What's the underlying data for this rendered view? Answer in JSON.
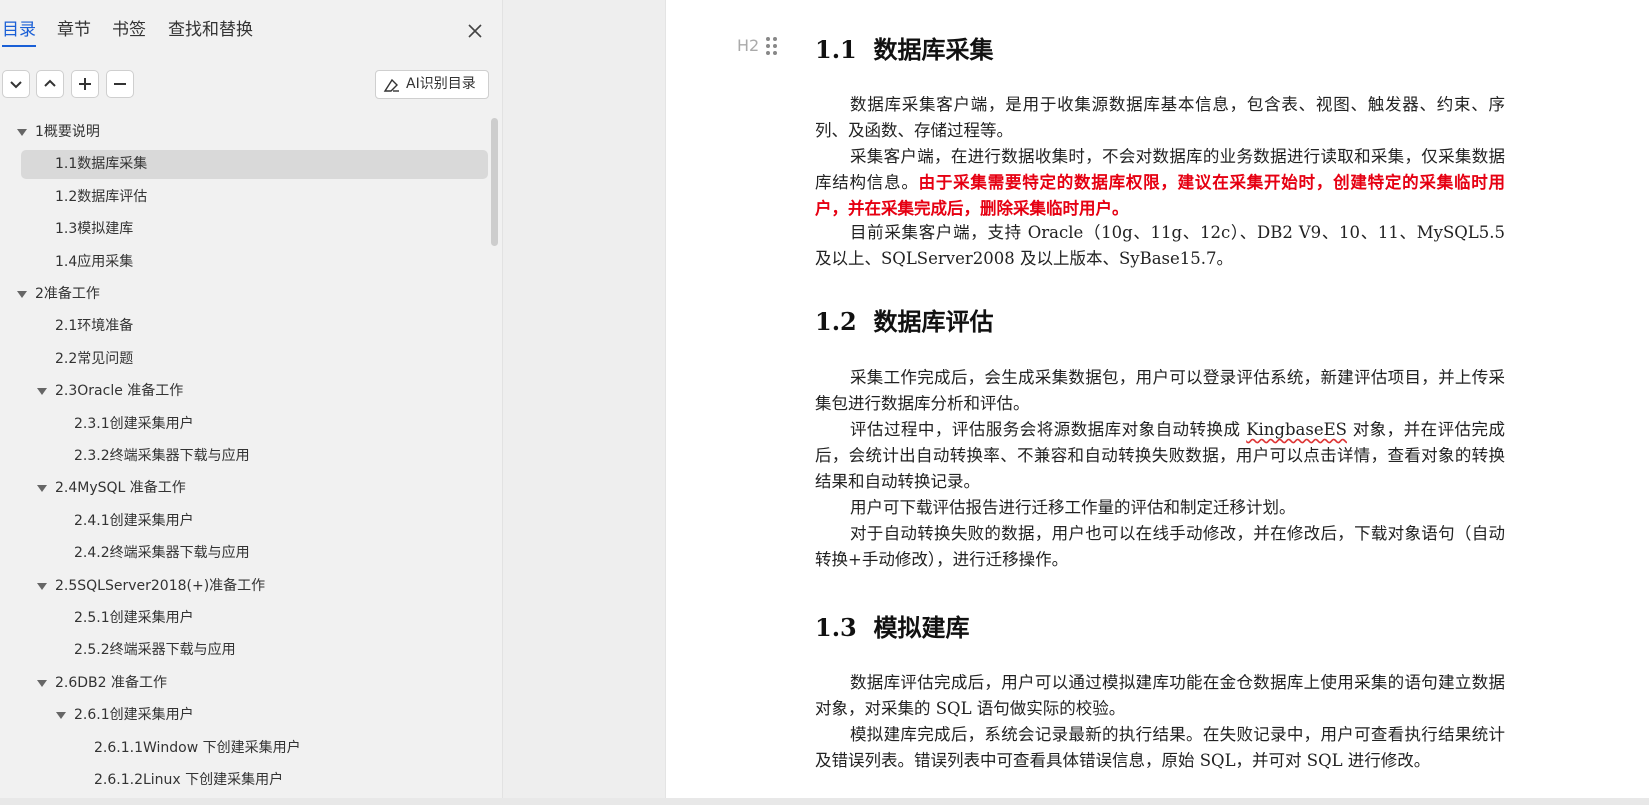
{
  "nav": {
    "tabs": [
      {
        "label": "目录",
        "active": true
      },
      {
        "label": "章节",
        "active": false
      },
      {
        "label": "书签",
        "active": false
      },
      {
        "label": "查找和替换",
        "active": false
      }
    ],
    "ai_button": "AI识别目录",
    "toc": [
      {
        "label": "1概要说明",
        "level": 0,
        "caret": "expanded"
      },
      {
        "label": "1.1数据库采集",
        "level": 1,
        "selected": true
      },
      {
        "label": "1.2数据库评估",
        "level": 1
      },
      {
        "label": "1.3模拟建库",
        "level": 1
      },
      {
        "label": "1.4应用采集",
        "level": 1
      },
      {
        "label": "2准备工作",
        "level": 0,
        "caret": "expanded"
      },
      {
        "label": "2.1环境准备",
        "level": 1
      },
      {
        "label": "2.2常见问题",
        "level": 1
      },
      {
        "label": "2.3Oracle 准备工作",
        "level": 1,
        "caret": "expanded"
      },
      {
        "label": "2.3.1创建采集用户",
        "level": 2
      },
      {
        "label": "2.3.2终端采集器下载与应用",
        "level": 2
      },
      {
        "label": "2.4MySQL 准备工作",
        "level": 1,
        "caret": "expanded"
      },
      {
        "label": "2.4.1创建采集用户",
        "level": 2
      },
      {
        "label": "2.4.2终端采集器下载与应用",
        "level": 2
      },
      {
        "label": "2.5SQLServer2018(+)准备工作",
        "level": 1,
        "caret": "expanded"
      },
      {
        "label": "2.5.1创建采集用户",
        "level": 2
      },
      {
        "label": "2.5.2终端采器下载与应用",
        "level": 2
      },
      {
        "label": "2.6DB2 准备工作",
        "level": 1,
        "caret": "expanded"
      },
      {
        "label": "2.6.1创建采集用户",
        "level": 2,
        "caret": "expanded"
      },
      {
        "label": "2.6.1.1Window 下创建采集用户",
        "level": 3
      },
      {
        "label": "2.6.1.2Linux 下创建采集用户",
        "level": 3
      }
    ]
  },
  "doc": {
    "heading_marker": "H2",
    "sections": [
      {
        "num": "1.1",
        "title": "数据库采集",
        "paragraphs": [
          {
            "parts": [
              {
                "text": "数据库采集客户端，是用于收集源数据库基本信息，包含表、视图、触发器、约束、序列、及函数、存储过程等。"
              }
            ]
          },
          {
            "parts": [
              {
                "text": "采集客户端，在进行数据收集时，不会对数据库的业务数据进行读取和采集，仅采集数据库结构信息。"
              },
              {
                "text": "由于采集需要特定的数据库权限，建议在采集开始时，创建特定的采集临时用户，并在采集完成后，删除采集临时用户。",
                "red": true
              }
            ]
          },
          {
            "parts": [
              {
                "text": "目前采集客户端，支持 Oracle（10g、11g、12c）、DB2 V9、10、11、MySQL5.5 及以上、SQLServer2008 及以上版本、SyBase15.7。"
              }
            ]
          }
        ]
      },
      {
        "num": "1.2",
        "title": "数据库评估",
        "paragraphs": [
          {
            "parts": [
              {
                "text": "采集工作完成后，会生成采集数据包，用户可以登录评估系统，新建评估项目，并上传采集包进行数据库分析和评估。"
              }
            ]
          },
          {
            "parts": [
              {
                "text": "评估过程中，评估服务会将源数据库对象自动转换成 "
              },
              {
                "text": "KingbaseES",
                "wave": true
              },
              {
                "text": " 对象，并在评估完成后，会统计出自动转换率、不兼容和自动转换失败数据，用户可以点击详情，查看对象的转换结果和自动转换记录。"
              }
            ]
          },
          {
            "parts": [
              {
                "text": "用户可下载评估报告进行迁移工作量的评估和制定迁移计划。"
              }
            ]
          },
          {
            "parts": [
              {
                "text": "对于自动转换失败的数据，用户也可以在线手动修改，并在修改后，下载对象语句（自动转换+手动修改），进行迁移操作。"
              }
            ]
          }
        ]
      },
      {
        "num": "1.3",
        "title": "模拟建库",
        "paragraphs": [
          {
            "parts": [
              {
                "text": "数据库评估完成后，用户可以通过模拟建库功能在金仓数据库上使用采集的语句建立数据对象，对采集的 SQL 语句做实际的校验。"
              }
            ]
          },
          {
            "parts": [
              {
                "text": "模拟建库完成后，系统会记录最新的执行结果。在失败记录中，用户可查看执行结果统计及错误列表。错误列表中可查看具体错误信息，原始 SQL，并可对 SQL 进行修改。"
              }
            ]
          }
        ]
      }
    ]
  }
}
